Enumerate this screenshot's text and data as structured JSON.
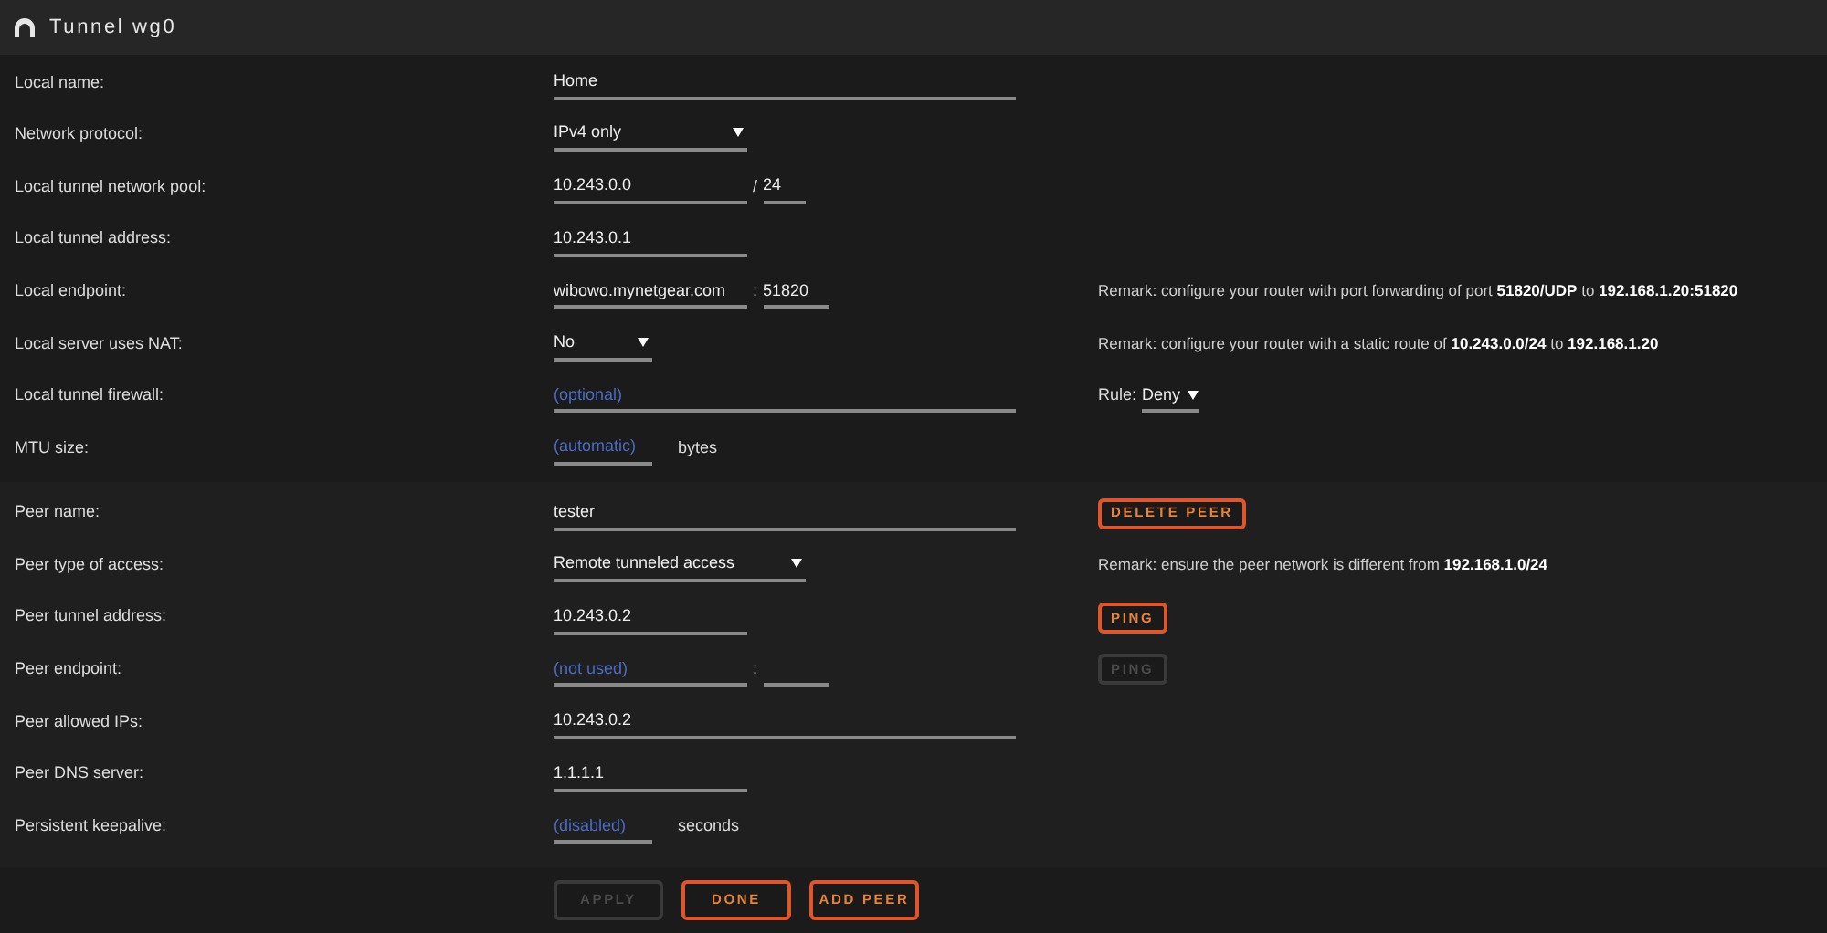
{
  "header": {
    "title": "Tunnel wg0"
  },
  "sections": [
    {
      "rows": [
        {
          "label": "Local name:",
          "fields": [
            {
              "kind": "input",
              "value": "Home"
            }
          ]
        },
        {
          "label": "Network protocol:",
          "fields": [
            {
              "kind": "select",
              "value": "IPv4 only"
            }
          ]
        },
        {
          "label": "Local tunnel network pool:",
          "fields": [
            {
              "kind": "input",
              "value": "10.243.0.0"
            },
            {
              "kind": "input",
              "prefix": "/",
              "value": "24"
            }
          ]
        },
        {
          "label": "Local tunnel address:",
          "fields": [
            {
              "kind": "input",
              "value": "10.243.0.1"
            }
          ]
        },
        {
          "label": "Local endpoint:",
          "fields": [
            {
              "kind": "input",
              "value": "wibowo.mynetgear.com"
            },
            {
              "kind": "input",
              "prefix": ":",
              "value": "51820"
            }
          ],
          "side": {
            "kind": "remark",
            "text": "Remark: configure your router with port forwarding of port **51820/UDP** to **192.168.1.20:51820**"
          }
        },
        {
          "label": "Local server uses NAT:",
          "fields": [
            {
              "kind": "select",
              "value": "No"
            }
          ],
          "side": {
            "kind": "remark",
            "text": "Remark: configure your router with a static route of **10.243.0.0/24** to **192.168.1.20**"
          }
        },
        {
          "label": "Local tunnel firewall:",
          "fields": [
            {
              "kind": "input",
              "placeholder": "(optional)"
            }
          ],
          "side": {
            "kind": "select",
            "label": "Rule:",
            "value": "Deny"
          }
        },
        {
          "label": "MTU size:",
          "fields": [
            {
              "kind": "input",
              "placeholder": "(automatic)"
            }
          ],
          "suffix": "bytes"
        }
      ]
    },
    {
      "rows": [
        {
          "label": "Peer name:",
          "fields": [
            {
              "kind": "input",
              "value": "tester"
            }
          ],
          "side": {
            "kind": "button",
            "text": "DELETE PEER",
            "disabled": false
          }
        },
        {
          "label": "Peer type of access:",
          "fields": [
            {
              "kind": "select",
              "value": "Remote tunneled access"
            }
          ],
          "side": {
            "kind": "remark",
            "text": "Remark: ensure the peer network is different from **192.168.1.0/24**"
          }
        },
        {
          "label": "Peer tunnel address:",
          "fields": [
            {
              "kind": "input",
              "value": "10.243.0.2"
            }
          ],
          "side": {
            "kind": "button",
            "text": "PING",
            "disabled": false
          }
        },
        {
          "label": "Peer endpoint:",
          "fields": [
            {
              "kind": "input",
              "placeholder": "(not used)"
            },
            {
              "kind": "input",
              "prefix": ":"
            }
          ],
          "side": {
            "kind": "button",
            "text": "PING",
            "disabled": true
          }
        },
        {
          "label": "Peer allowed IPs:",
          "fields": [
            {
              "kind": "input",
              "value": "10.243.0.2"
            }
          ]
        },
        {
          "label": "Peer DNS server:",
          "fields": [
            {
              "kind": "input",
              "value": "1.1.1.1"
            }
          ]
        },
        {
          "label": "Persistent keepalive:",
          "fields": [
            {
              "kind": "input",
              "placeholder": "(disabled)"
            }
          ],
          "suffix": "seconds"
        }
      ]
    }
  ],
  "footer": {
    "buttons": [
      {
        "text": "APPLY",
        "disabled": true
      },
      {
        "text": "DONE",
        "disabled": false
      },
      {
        "text": "ADD PEER",
        "disabled": false
      }
    ]
  }
}
